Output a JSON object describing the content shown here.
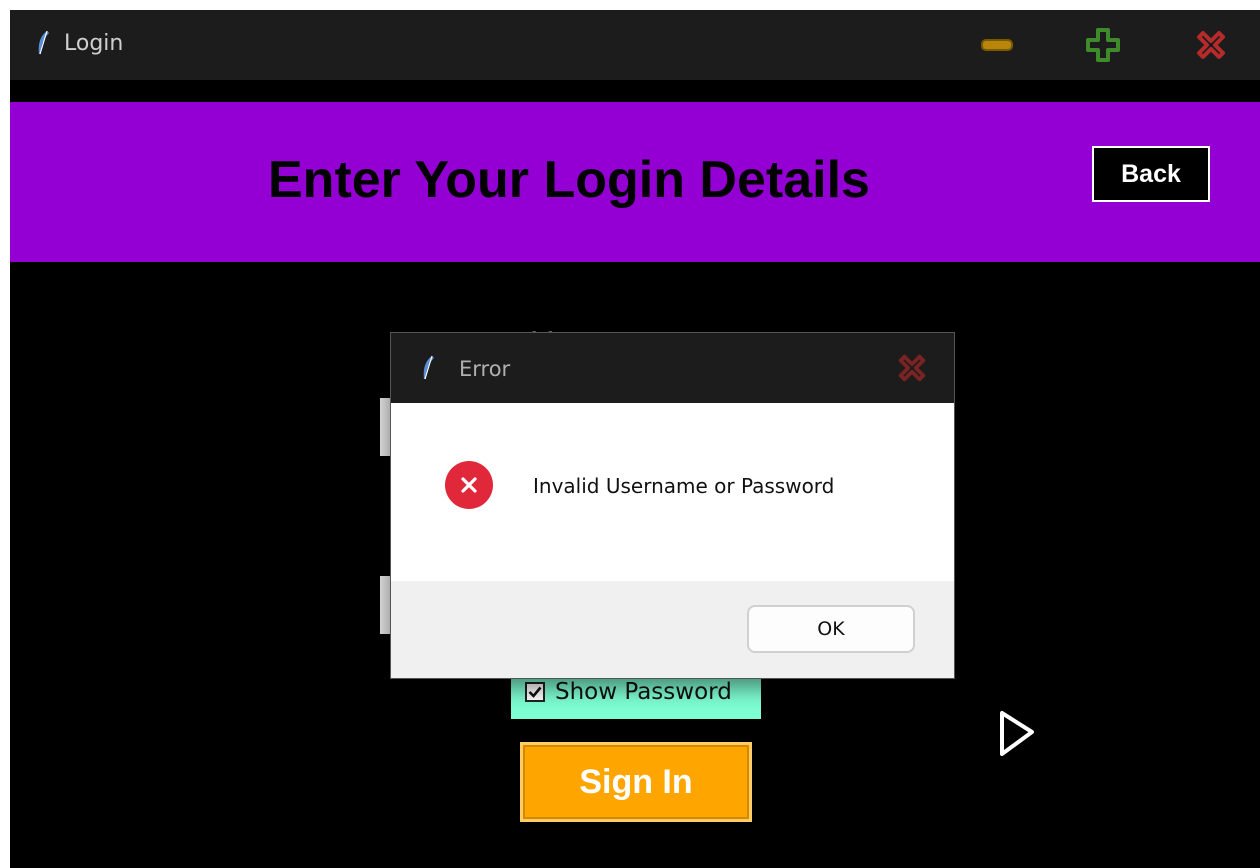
{
  "window": {
    "title": "Login",
    "controls": {
      "minimize_icon": "minimize-icon",
      "maximize_icon": "plus-icon",
      "close_icon": "close-icon"
    }
  },
  "header": {
    "title": "Enter Your Login Details",
    "back_label": "Back",
    "background": "#9400d3"
  },
  "form": {
    "username_label": "Username",
    "show_password_label": "Show Password",
    "show_password_checked": true,
    "sign_in_label": "Sign In",
    "sign_in_color": "#ffa500",
    "checkbox_bg": "#7fffd4"
  },
  "dialog": {
    "title": "Error",
    "message": "Invalid Username or Password",
    "ok_label": "OK",
    "icon": "error-icon"
  }
}
